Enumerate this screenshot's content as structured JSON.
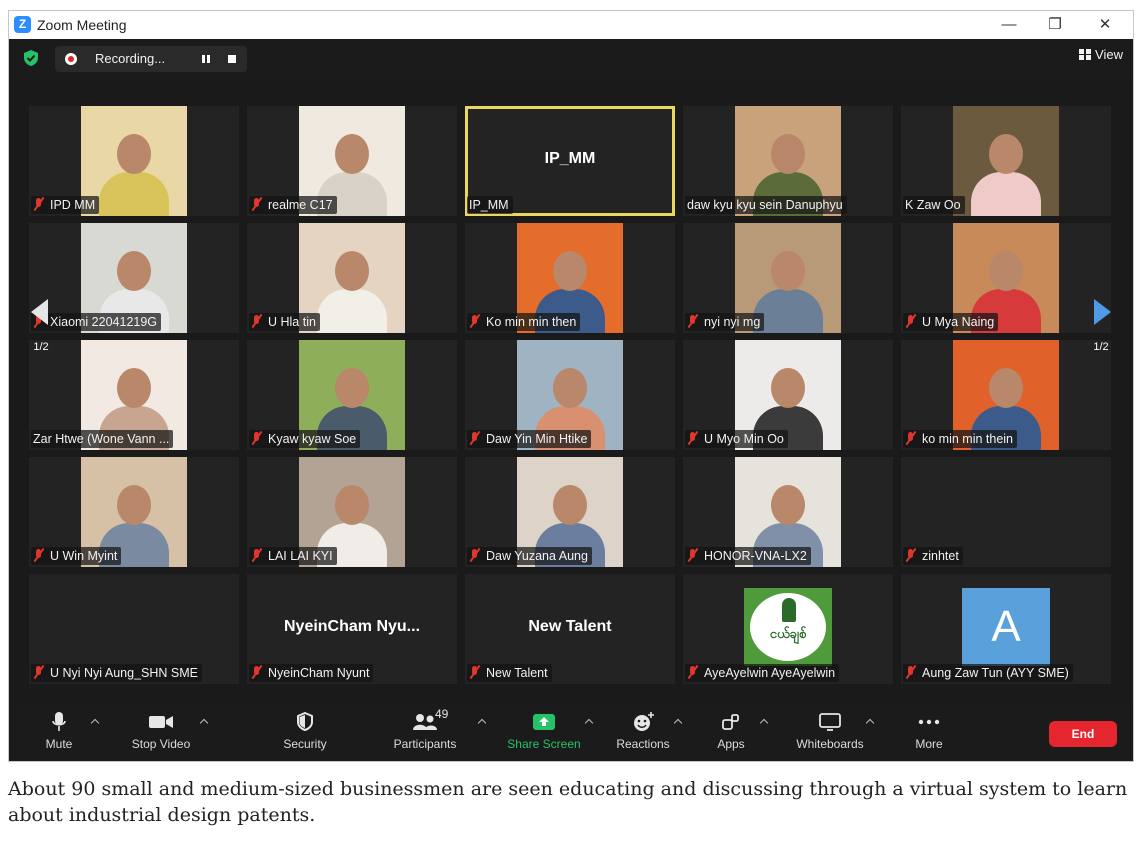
{
  "window": {
    "title": "Zoom Meeting",
    "controls": {
      "minimize": "—",
      "restore": "❐",
      "close": "✕"
    }
  },
  "topbar": {
    "recording_label": "Recording...",
    "view_label": "View"
  },
  "gallery": {
    "page_indicator_left": "1/2",
    "page_indicator_right": "1/2",
    "tiles": [
      {
        "name": "IPD MM",
        "muted": true,
        "kind": "video",
        "bg": "#e9d7a6",
        "shirt": "#d8c45a"
      },
      {
        "name": "realme C17",
        "muted": true,
        "kind": "video",
        "bg": "#efe9df",
        "shirt": "#d8d2c8"
      },
      {
        "name": "IP_MM",
        "display_name": "IP_MM",
        "muted": false,
        "kind": "name",
        "active": true
      },
      {
        "name": "daw kyu kyu sein Danuphyu",
        "muted": false,
        "kind": "video",
        "bg": "#c7a27a",
        "shirt": "#5c6b3a"
      },
      {
        "name": "K Zaw Oo",
        "muted": false,
        "kind": "video",
        "bg": "#6c5a3e",
        "shirt": "#f0c9c9"
      },
      {
        "name": "Xiaomi 22041219G",
        "muted": true,
        "kind": "video",
        "bg": "#d9d9d4",
        "shirt": "#e8e8e8"
      },
      {
        "name": "U Hla tin",
        "muted": true,
        "kind": "video",
        "bg": "#e6d4c2",
        "shirt": "#f2efe8"
      },
      {
        "name": "Ko min min then",
        "muted": true,
        "kind": "video",
        "bg": "#e46d2c",
        "shirt": "#3c5a8a"
      },
      {
        "name": "nyi nyi mg",
        "muted": true,
        "kind": "video",
        "bg": "#b99a78",
        "shirt": "#6b8096"
      },
      {
        "name": "U Mya Naing",
        "muted": true,
        "kind": "video",
        "bg": "#c98a5a",
        "shirt": "#d73a3a"
      },
      {
        "name": "Zar Htwe (Wone Vann ...",
        "muted": false,
        "kind": "video",
        "bg": "#f1e9e2",
        "shirt": "#c8a590"
      },
      {
        "name": "Kyaw kyaw Soe",
        "muted": true,
        "kind": "video",
        "bg": "#8fae5a",
        "shirt": "#4a5b6b"
      },
      {
        "name": "Daw Yin Min Htike",
        "muted": true,
        "kind": "video",
        "bg": "#9fb3c2",
        "shirt": "#d89070"
      },
      {
        "name": "U Myo Min Oo",
        "muted": true,
        "kind": "video",
        "bg": "#ecebea",
        "shirt": "#3b3b3b"
      },
      {
        "name": "ko min min thein",
        "muted": true,
        "kind": "video",
        "bg": "#e0612a",
        "shirt": "#3c5a8a"
      },
      {
        "name": "U Win Myint",
        "muted": true,
        "kind": "video",
        "bg": "#d6c0a6",
        "shirt": "#7a8aa0"
      },
      {
        "name": "LAI LAI KYI",
        "muted": true,
        "kind": "video",
        "bg": "#b3a394",
        "shirt": "#f0ece8"
      },
      {
        "name": "Daw Yuzana Aung",
        "muted": true,
        "kind": "video",
        "bg": "#ddd3c8",
        "shirt": "#6c7ea0"
      },
      {
        "name": "HONOR-VNA-LX2",
        "muted": true,
        "kind": "video",
        "bg": "#e6e3dd",
        "shirt": "#8090a8"
      },
      {
        "name": "zinhtet",
        "muted": true,
        "kind": "empty"
      },
      {
        "name": "U Nyi Nyi Aung_SHN SME",
        "muted": true,
        "kind": "empty"
      },
      {
        "name": "NyeinCham Nyunt",
        "display_name": "NyeinCham Nyu...",
        "muted": true,
        "kind": "name"
      },
      {
        "name": "New Talent",
        "display_name": "New Talent",
        "muted": true,
        "kind": "name"
      },
      {
        "name": "AyeAyelwin AyeAyelwin",
        "muted": true,
        "kind": "logo",
        "logo_text": "ငယ်ချစ်"
      },
      {
        "name": "Aung Zaw Tun (AYY SME)",
        "muted": true,
        "kind": "avatar",
        "avatar_letter": "A"
      }
    ]
  },
  "toolbar": {
    "mute": "Mute",
    "stop_video": "Stop Video",
    "security": "Security",
    "participants": "Participants",
    "participants_count": "49",
    "share_screen": "Share Screen",
    "reactions": "Reactions",
    "apps": "Apps",
    "whiteboards": "Whiteboards",
    "more": "More",
    "end": "End"
  },
  "icons": {
    "shield": "shield-check-icon",
    "mic": "microphone-icon",
    "camera": "video-camera-icon",
    "security": "shield-icon",
    "participants": "people-icon",
    "share": "share-up-arrow-icon",
    "reactions": "emoji-plus-icon",
    "apps": "apps-icon",
    "whiteboard": "whiteboard-icon",
    "more": "ellipsis-icon"
  },
  "colors": {
    "meeting_bg": "#1a1a1a",
    "active_speaker": "#e8d860",
    "share_green": "#26c26a",
    "end_red": "#e5262e",
    "mic_off_red": "#e0362e"
  },
  "caption": "About 90 small and medium-sized businessmen are seen educating and discussing through a virtual system to learn about industrial design patents."
}
